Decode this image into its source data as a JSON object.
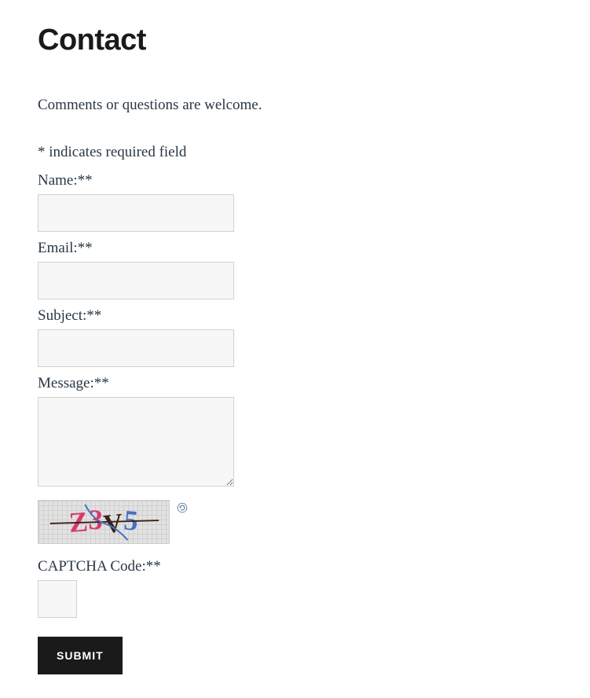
{
  "page": {
    "title": "Contact",
    "intro": "Comments or questions are welcome.",
    "required_note": "* indicates required field"
  },
  "fields": {
    "name": {
      "label": "Name:",
      "required_marker": "*",
      "value": ""
    },
    "email": {
      "label": "Email:",
      "required_marker": "*",
      "value": ""
    },
    "subject": {
      "label": "Subject:",
      "required_marker": "*",
      "value": ""
    },
    "message": {
      "label": "Message:",
      "required_marker": "*",
      "value": ""
    },
    "captcha": {
      "label": "CAPTCHA Code:",
      "required_marker": "*",
      "value": ""
    }
  },
  "captcha_image_text": "Z3V5",
  "submit_label": "SUBMIT"
}
